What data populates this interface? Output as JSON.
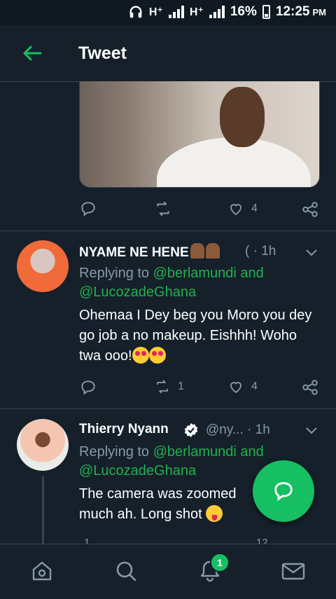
{
  "status_bar": {
    "net1": "H⁺",
    "net2": "H⁺",
    "battery": "16%",
    "time": "12:25",
    "ampm": "PM"
  },
  "header": {
    "title": "Tweet"
  },
  "main_tweet": {
    "like_count": "4"
  },
  "replies": [
    {
      "name": "NYAME NE HENE",
      "meta": "( · 1h",
      "replying_prefix": "Replying to ",
      "mention1": "@berlamundi",
      "and": " and",
      "mention2": "@LucozadeGhana",
      "text": "Ohemaa I Dey beg you Moro you dey go job a no  makeup. Eishhh! Woho twa ooo!",
      "retweet_count": "1",
      "like_count": "4"
    },
    {
      "name": "Thierry Nyann",
      "meta": "@ny... · 1h",
      "replying_prefix": "Replying to ",
      "mention1": "@berlamundi",
      "and": " and",
      "mention2": "@LucozadeGhana",
      "text": "The camera was zoomed much ah. Long shot",
      "peek_reply": "1",
      "peek_like": "12"
    }
  ],
  "bottom_nav": {
    "notifications_badge": "1"
  },
  "colors": {
    "background": "#15202b",
    "accent": "#17bf63",
    "muted": "#8899a6",
    "divider": "#38444d"
  }
}
